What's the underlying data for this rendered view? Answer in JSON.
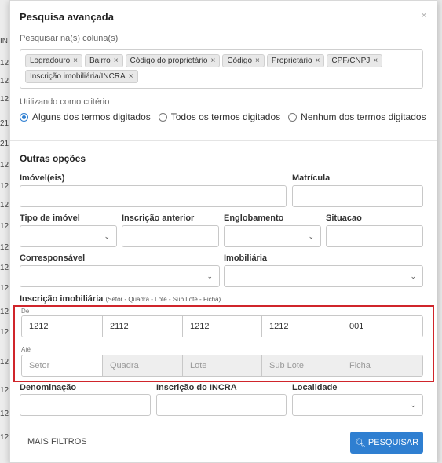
{
  "background": {
    "column_cells": [
      "IN",
      "12",
      "12",
      "12",
      "21",
      "21",
      "12",
      "12",
      "12",
      "12",
      "12",
      "12",
      "12",
      "12",
      "12",
      "12",
      "12",
      "12",
      "12"
    ]
  },
  "modal": {
    "title": "Pesquisa avançada",
    "close_label": "×",
    "columns_label": "Pesquisar na(s) coluna(s)",
    "tags": [
      {
        "label": "Logradouro"
      },
      {
        "label": "Bairro"
      },
      {
        "label": "Código do proprietário"
      },
      {
        "label": "Código"
      },
      {
        "label": "Proprietário"
      },
      {
        "label": "CPF/CNPJ"
      },
      {
        "label": "Inscrição imobiliária/INCRA"
      }
    ],
    "tag_remove": "×",
    "criteria_label": "Utilizando como critério",
    "criteria_options": [
      {
        "label": "Alguns dos termos digitados",
        "selected": true
      },
      {
        "label": "Todos os termos digitados",
        "selected": false
      },
      {
        "label": "Nenhum dos termos digitados",
        "selected": false
      }
    ],
    "other_options_title": "Outras opções",
    "fields": {
      "imovel": {
        "label": "Imóvel(eis)",
        "value": ""
      },
      "matricula": {
        "label": "Matrícula",
        "value": ""
      },
      "tipo_imovel": {
        "label": "Tipo de imóvel",
        "value": ""
      },
      "inscricao_anterior": {
        "label": "Inscrição anterior",
        "value": ""
      },
      "englobamento": {
        "label": "Englobamento",
        "value": ""
      },
      "situacao": {
        "label": "Situacao",
        "value": ""
      },
      "corresponsavel": {
        "label": "Corresponsável",
        "value": ""
      },
      "imobiliaria": {
        "label": "Imobiliária",
        "value": ""
      },
      "denominacao": {
        "label": "Denominação",
        "value": ""
      },
      "inscricao_incra": {
        "label": "Inscrição do INCRA",
        "value": ""
      },
      "localidade": {
        "label": "Localidade",
        "value": ""
      }
    },
    "inscricao": {
      "label": "Inscrição imobiliária",
      "hint": "(Setor - Quadra - Lote - Sub Lote - Ficha)",
      "de_label": "De",
      "ate_label": "Até",
      "de_values": [
        "1212",
        "2112",
        "1212",
        "1212",
        "001"
      ],
      "ate_placeholders": [
        "Setor",
        "Quadra",
        "Lote",
        "Sub Lote",
        "Ficha"
      ]
    },
    "more_filters": "MAIS FILTROS",
    "search_button": "PESQUISAR",
    "search_icon": "search-icon"
  },
  "colors": {
    "accent": "#2f7fd1",
    "highlight_frame": "#d0252b"
  }
}
